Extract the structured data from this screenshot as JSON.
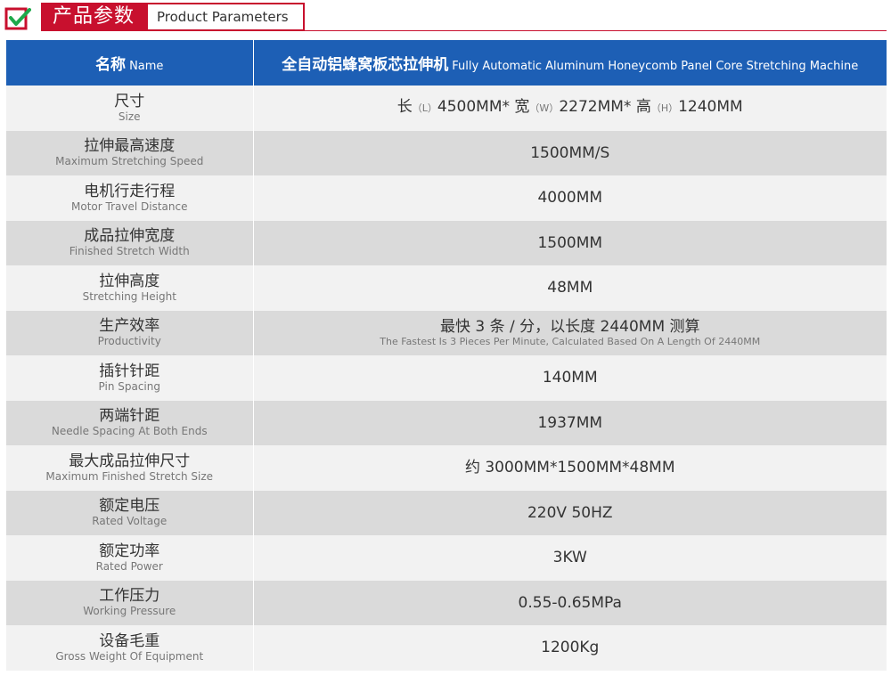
{
  "header": {
    "title_cn": "产品参数",
    "title_en": "Product Parameters",
    "accent_color": "#c8102e",
    "icon": "check-box-icon"
  },
  "table": {
    "header_color": "#1d5fb5",
    "col1": {
      "cn": "名称",
      "en": "Name"
    },
    "col2": {
      "cn": "全自动铝蜂窝板芯拉伸机",
      "en": "Fully Automatic Aluminum Honeycomb Panel Core Stretching Machine"
    },
    "size": {
      "cn": "尺寸",
      "en": "Size",
      "len_cn": "长",
      "len_code": "（L）",
      "len_val": "4500MM*",
      "wid_cn": "宽",
      "wid_code": "（W）",
      "wid_val": "2272MM*",
      "hgt_cn": "高",
      "hgt_code": "（H）",
      "hgt_val": "1240MM"
    },
    "rows": [
      {
        "cn": "拉伸最高速度",
        "en": "Maximum Stretching Speed",
        "value": "1500MM/S"
      },
      {
        "cn": "电机行走行程",
        "en": "Motor Travel Distance",
        "value": "4000MM"
      },
      {
        "cn": "成品拉伸宽度",
        "en": "Finished Stretch Width",
        "value": "1500MM"
      },
      {
        "cn": "拉伸高度",
        "en": "Stretching Height",
        "value": "48MM"
      },
      {
        "cn": "生产效率",
        "en": "Productivity",
        "value": "最快 3 条 / 分，以长度 2440MM 测算",
        "value_en": "The Fastest Is 3 Pieces Per Minute, Calculated Based On A Length Of 2440MM"
      },
      {
        "cn": "插针针距",
        "en": "Pin Spacing",
        "value": "140MM"
      },
      {
        "cn": "两端针距",
        "en": "Needle Spacing At Both Ends",
        "value": "1937MM"
      },
      {
        "cn": "最大成品拉伸尺寸",
        "en": "Maximum Finished Stretch Size",
        "value": "约 3000MM*1500MM*48MM"
      },
      {
        "cn": "额定电压",
        "en": "Rated Voltage",
        "value": "220V 50HZ"
      },
      {
        "cn": "额定功率",
        "en": "Rated Power",
        "value": "3KW"
      },
      {
        "cn": "工作压力",
        "en": "Working Pressure",
        "value": "0.55-0.65MPa"
      },
      {
        "cn": "设备毛重",
        "en": "Gross Weight Of Equipment",
        "value": "1200Kg"
      }
    ]
  }
}
